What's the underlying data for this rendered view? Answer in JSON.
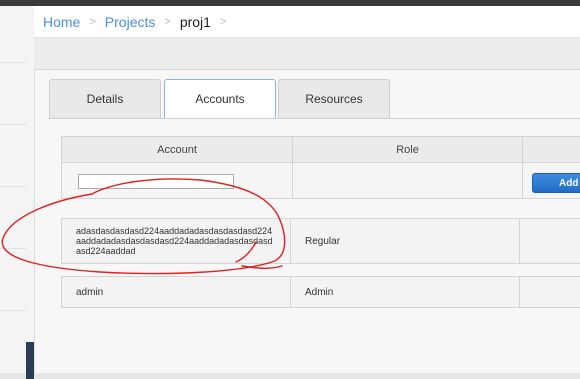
{
  "breadcrumb": {
    "items": [
      {
        "label": "Home"
      },
      {
        "label": "Projects"
      }
    ],
    "current": "proj1",
    "separator": ">"
  },
  "tabs": [
    {
      "label": "Details",
      "active": false
    },
    {
      "label": "Accounts",
      "active": true
    },
    {
      "label": "Resources",
      "active": false
    }
  ],
  "table": {
    "columns": [
      "Account",
      "Role"
    ],
    "add_button_label": "Add",
    "account_input_value": "",
    "rows": [
      {
        "account": "adasdasdasdasd224aaddadadasdasdasdasd224aaddadadasdasdasdasd224aaddadadasdasdasdasd224aaddad",
        "role": "Regular"
      },
      {
        "account": "admin",
        "role": "Admin"
      }
    ]
  },
  "colors": {
    "breadcrumb_link": "#4a90d9",
    "active_tab_border": "#8cb4dc",
    "add_button": "#1f6cc7",
    "annotation_stroke": "#e02020"
  }
}
